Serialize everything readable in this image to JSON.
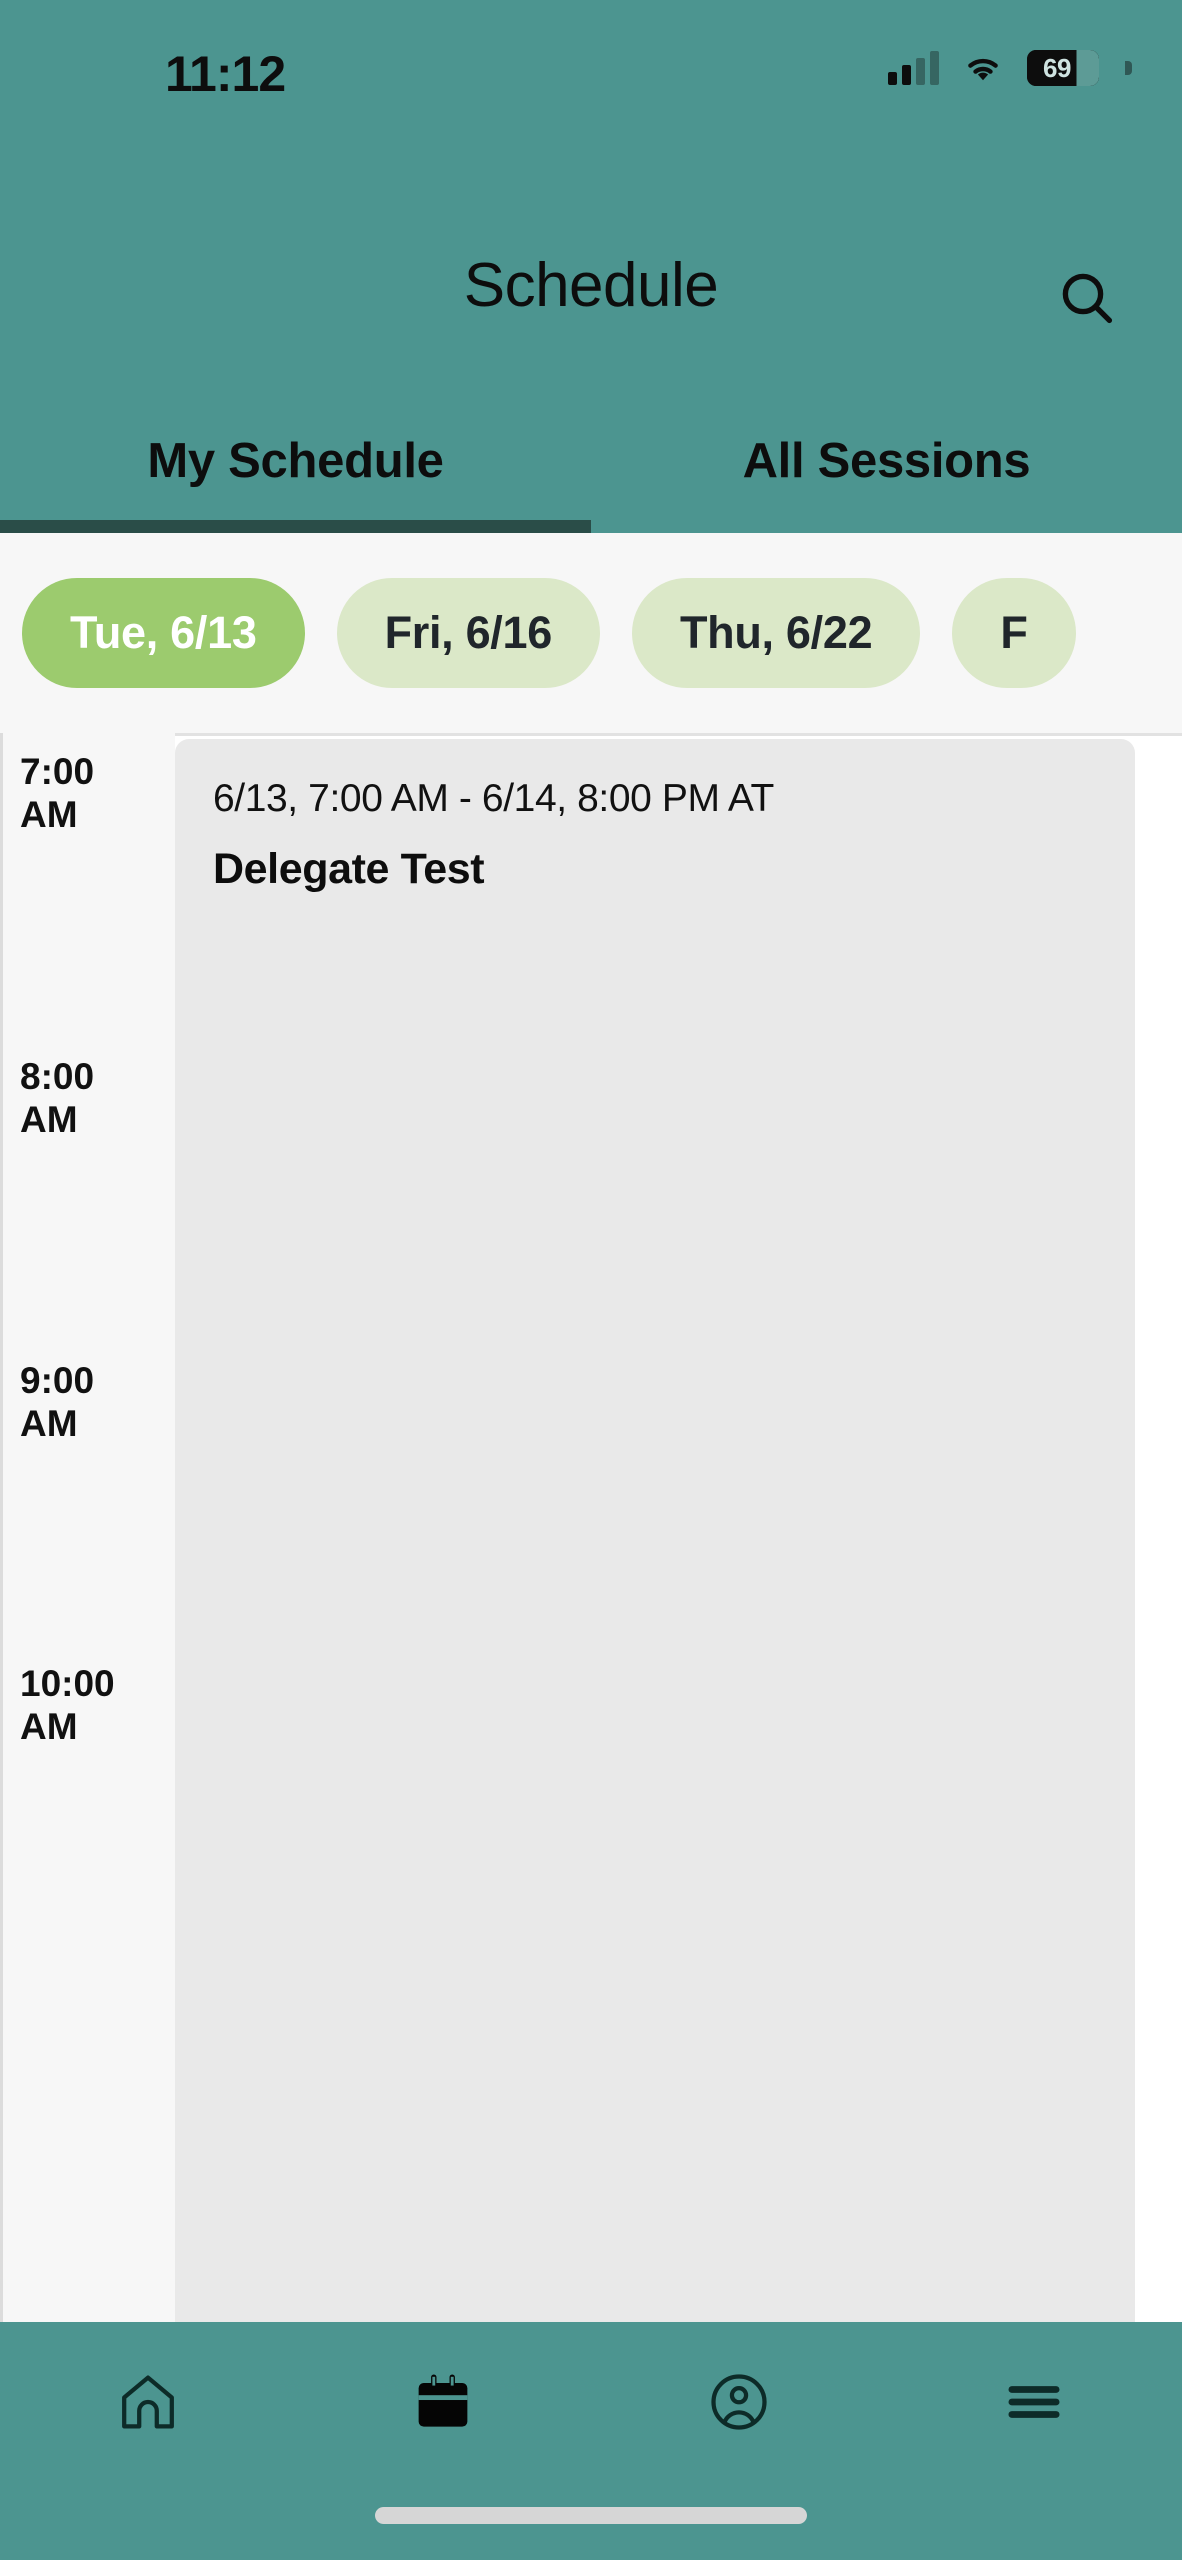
{
  "status_bar": {
    "time": "11:12",
    "battery_percent": "69",
    "signal_icon": "cellular-signal-icon",
    "wifi_icon": "wifi-icon",
    "battery_icon": "battery-icon"
  },
  "header": {
    "title": "Schedule",
    "search_icon": "search-icon",
    "accent_color": "#4C9590",
    "underline_color": "#2A4D48"
  },
  "tabs": [
    {
      "label": "My Schedule",
      "active": true
    },
    {
      "label": "All Sessions",
      "active": false
    }
  ],
  "date_chips": {
    "active_color": "#9CCB6E",
    "inactive_color": "#DBE8C8",
    "items": [
      {
        "label": "Tue, 6/13",
        "active": true
      },
      {
        "label": "Fri, 6/16",
        "active": false
      },
      {
        "label": "Thu, 6/22",
        "active": false
      },
      {
        "label": "F",
        "active": false
      }
    ]
  },
  "schedule": {
    "time_ticks": [
      {
        "hour": "7:00",
        "meridiem": "AM"
      },
      {
        "hour": "8:00",
        "meridiem": "AM"
      },
      {
        "hour": "9:00",
        "meridiem": "AM"
      },
      {
        "hour": "10:00",
        "meridiem": "AM"
      }
    ],
    "events": [
      {
        "time_range": "6/13, 7:00 AM - 6/14, 8:00 PM AT",
        "title": "Delegate Test"
      }
    ]
  },
  "bottom_nav": [
    {
      "name": "home",
      "icon": "home-icon",
      "active": false
    },
    {
      "name": "schedule",
      "icon": "calendar-icon",
      "active": true
    },
    {
      "name": "profile",
      "icon": "user-circle-icon",
      "active": false
    },
    {
      "name": "more",
      "icon": "hamburger-menu-icon",
      "active": false
    }
  ]
}
